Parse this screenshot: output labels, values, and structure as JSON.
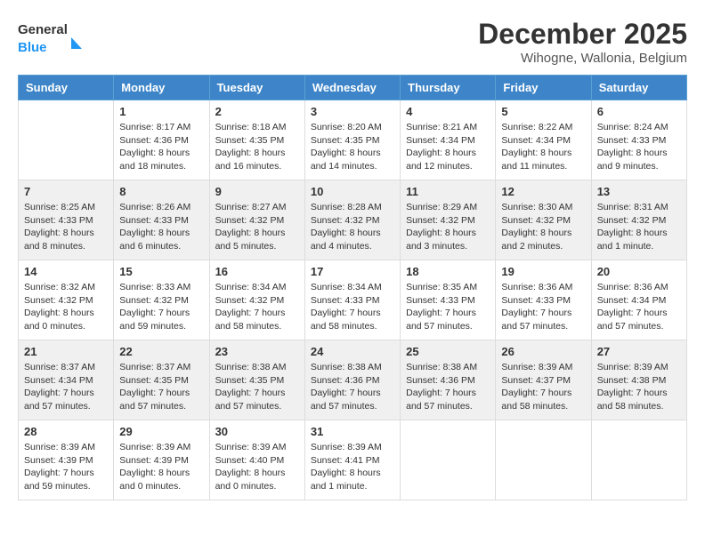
{
  "logo": {
    "general": "General",
    "blue": "Blue"
  },
  "header": {
    "month": "December 2025",
    "location": "Wihogne, Wallonia, Belgium"
  },
  "weekdays": [
    "Sunday",
    "Monday",
    "Tuesday",
    "Wednesday",
    "Thursday",
    "Friday",
    "Saturday"
  ],
  "weeks": [
    [
      {
        "day": "",
        "info": ""
      },
      {
        "day": "1",
        "info": "Sunrise: 8:17 AM\nSunset: 4:36 PM\nDaylight: 8 hours\nand 18 minutes."
      },
      {
        "day": "2",
        "info": "Sunrise: 8:18 AM\nSunset: 4:35 PM\nDaylight: 8 hours\nand 16 minutes."
      },
      {
        "day": "3",
        "info": "Sunrise: 8:20 AM\nSunset: 4:35 PM\nDaylight: 8 hours\nand 14 minutes."
      },
      {
        "day": "4",
        "info": "Sunrise: 8:21 AM\nSunset: 4:34 PM\nDaylight: 8 hours\nand 12 minutes."
      },
      {
        "day": "5",
        "info": "Sunrise: 8:22 AM\nSunset: 4:34 PM\nDaylight: 8 hours\nand 11 minutes."
      },
      {
        "day": "6",
        "info": "Sunrise: 8:24 AM\nSunset: 4:33 PM\nDaylight: 8 hours\nand 9 minutes."
      }
    ],
    [
      {
        "day": "7",
        "info": "Sunrise: 8:25 AM\nSunset: 4:33 PM\nDaylight: 8 hours\nand 8 minutes."
      },
      {
        "day": "8",
        "info": "Sunrise: 8:26 AM\nSunset: 4:33 PM\nDaylight: 8 hours\nand 6 minutes."
      },
      {
        "day": "9",
        "info": "Sunrise: 8:27 AM\nSunset: 4:32 PM\nDaylight: 8 hours\nand 5 minutes."
      },
      {
        "day": "10",
        "info": "Sunrise: 8:28 AM\nSunset: 4:32 PM\nDaylight: 8 hours\nand 4 minutes."
      },
      {
        "day": "11",
        "info": "Sunrise: 8:29 AM\nSunset: 4:32 PM\nDaylight: 8 hours\nand 3 minutes."
      },
      {
        "day": "12",
        "info": "Sunrise: 8:30 AM\nSunset: 4:32 PM\nDaylight: 8 hours\nand 2 minutes."
      },
      {
        "day": "13",
        "info": "Sunrise: 8:31 AM\nSunset: 4:32 PM\nDaylight: 8 hours\nand 1 minute."
      }
    ],
    [
      {
        "day": "14",
        "info": "Sunrise: 8:32 AM\nSunset: 4:32 PM\nDaylight: 8 hours\nand 0 minutes."
      },
      {
        "day": "15",
        "info": "Sunrise: 8:33 AM\nSunset: 4:32 PM\nDaylight: 7 hours\nand 59 minutes."
      },
      {
        "day": "16",
        "info": "Sunrise: 8:34 AM\nSunset: 4:32 PM\nDaylight: 7 hours\nand 58 minutes."
      },
      {
        "day": "17",
        "info": "Sunrise: 8:34 AM\nSunset: 4:33 PM\nDaylight: 7 hours\nand 58 minutes."
      },
      {
        "day": "18",
        "info": "Sunrise: 8:35 AM\nSunset: 4:33 PM\nDaylight: 7 hours\nand 57 minutes."
      },
      {
        "day": "19",
        "info": "Sunrise: 8:36 AM\nSunset: 4:33 PM\nDaylight: 7 hours\nand 57 minutes."
      },
      {
        "day": "20",
        "info": "Sunrise: 8:36 AM\nSunset: 4:34 PM\nDaylight: 7 hours\nand 57 minutes."
      }
    ],
    [
      {
        "day": "21",
        "info": "Sunrise: 8:37 AM\nSunset: 4:34 PM\nDaylight: 7 hours\nand 57 minutes."
      },
      {
        "day": "22",
        "info": "Sunrise: 8:37 AM\nSunset: 4:35 PM\nDaylight: 7 hours\nand 57 minutes."
      },
      {
        "day": "23",
        "info": "Sunrise: 8:38 AM\nSunset: 4:35 PM\nDaylight: 7 hours\nand 57 minutes."
      },
      {
        "day": "24",
        "info": "Sunrise: 8:38 AM\nSunset: 4:36 PM\nDaylight: 7 hours\nand 57 minutes."
      },
      {
        "day": "25",
        "info": "Sunrise: 8:38 AM\nSunset: 4:36 PM\nDaylight: 7 hours\nand 57 minutes."
      },
      {
        "day": "26",
        "info": "Sunrise: 8:39 AM\nSunset: 4:37 PM\nDaylight: 7 hours\nand 58 minutes."
      },
      {
        "day": "27",
        "info": "Sunrise: 8:39 AM\nSunset: 4:38 PM\nDaylight: 7 hours\nand 58 minutes."
      }
    ],
    [
      {
        "day": "28",
        "info": "Sunrise: 8:39 AM\nSunset: 4:39 PM\nDaylight: 7 hours\nand 59 minutes."
      },
      {
        "day": "29",
        "info": "Sunrise: 8:39 AM\nSunset: 4:39 PM\nDaylight: 8 hours\nand 0 minutes."
      },
      {
        "day": "30",
        "info": "Sunrise: 8:39 AM\nSunset: 4:40 PM\nDaylight: 8 hours\nand 0 minutes."
      },
      {
        "day": "31",
        "info": "Sunrise: 8:39 AM\nSunset: 4:41 PM\nDaylight: 8 hours\nand 1 minute."
      },
      {
        "day": "",
        "info": ""
      },
      {
        "day": "",
        "info": ""
      },
      {
        "day": "",
        "info": ""
      }
    ]
  ]
}
